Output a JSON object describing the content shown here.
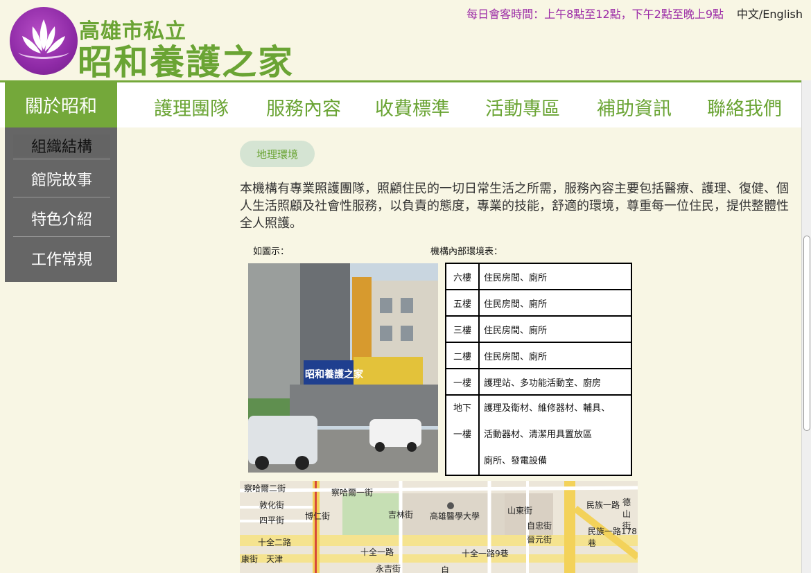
{
  "header": {
    "org_line1": "高雄市私立",
    "org_line2": "昭和養護之家",
    "visit_hours": "每日會客時間：上午8點至12點，下午2點至晚上9點",
    "language": "中文/English",
    "brand_green": "#6aa434",
    "brand_purple": "#8e2aa6"
  },
  "nav": {
    "active": "關於昭和",
    "items": [
      "護理團隊",
      "服務內容",
      "收費標準",
      "活動專區",
      "補助資訊",
      "聯絡我們"
    ]
  },
  "sidebar": {
    "items": [
      "組織結構",
      "館院故事",
      "特色介紹",
      "工作常規"
    ]
  },
  "content": {
    "section_tab": "地理環境",
    "intro": "本機構有專業照護團隊，照顧住民的一切日常生活之所需，服務內容主要包括醫療、護理、復健、個人生活照顧及社會性服務，以負責的態度，專業的技能，舒適的環境，尊重每一位住民，提供整體性全人照護。",
    "figure_label": "如圖示：",
    "table_label": "機構內部環境表：",
    "photo_sign_main": "昭和養護之家",
    "floors": [
      {
        "floor": "六樓",
        "desc": "住民房間、廁所"
      },
      {
        "floor": "五樓",
        "desc": "住民房間、廁所"
      },
      {
        "floor": "三樓",
        "desc": "住民房間、廁所"
      },
      {
        "floor": "二樓",
        "desc": "住民房間、廁所"
      },
      {
        "floor": "一樓",
        "desc": "護理站、多功能活動室、廚房"
      }
    ],
    "basement": {
      "floor_a": "地下",
      "floor_b": "一樓",
      "desc_1": "護理及衛材、維修器材、輔具、",
      "desc_2": "活動器材、清潔用具置放區",
      "desc_3": "廁所、發電設備"
    }
  },
  "map": {
    "labels": [
      "察哈爾二街",
      "察哈爾一街",
      "敦化街",
      "四平街",
      "博仁街",
      "吉林街",
      "高雄醫學大學",
      "十全二路",
      "十全一路",
      "天津",
      "永吉街",
      "十全一路9巷",
      "山東街",
      "自忠街",
      "晉元街",
      "民族一路",
      "民族一路178巷",
      "德山街",
      "康街",
      "自"
    ]
  }
}
